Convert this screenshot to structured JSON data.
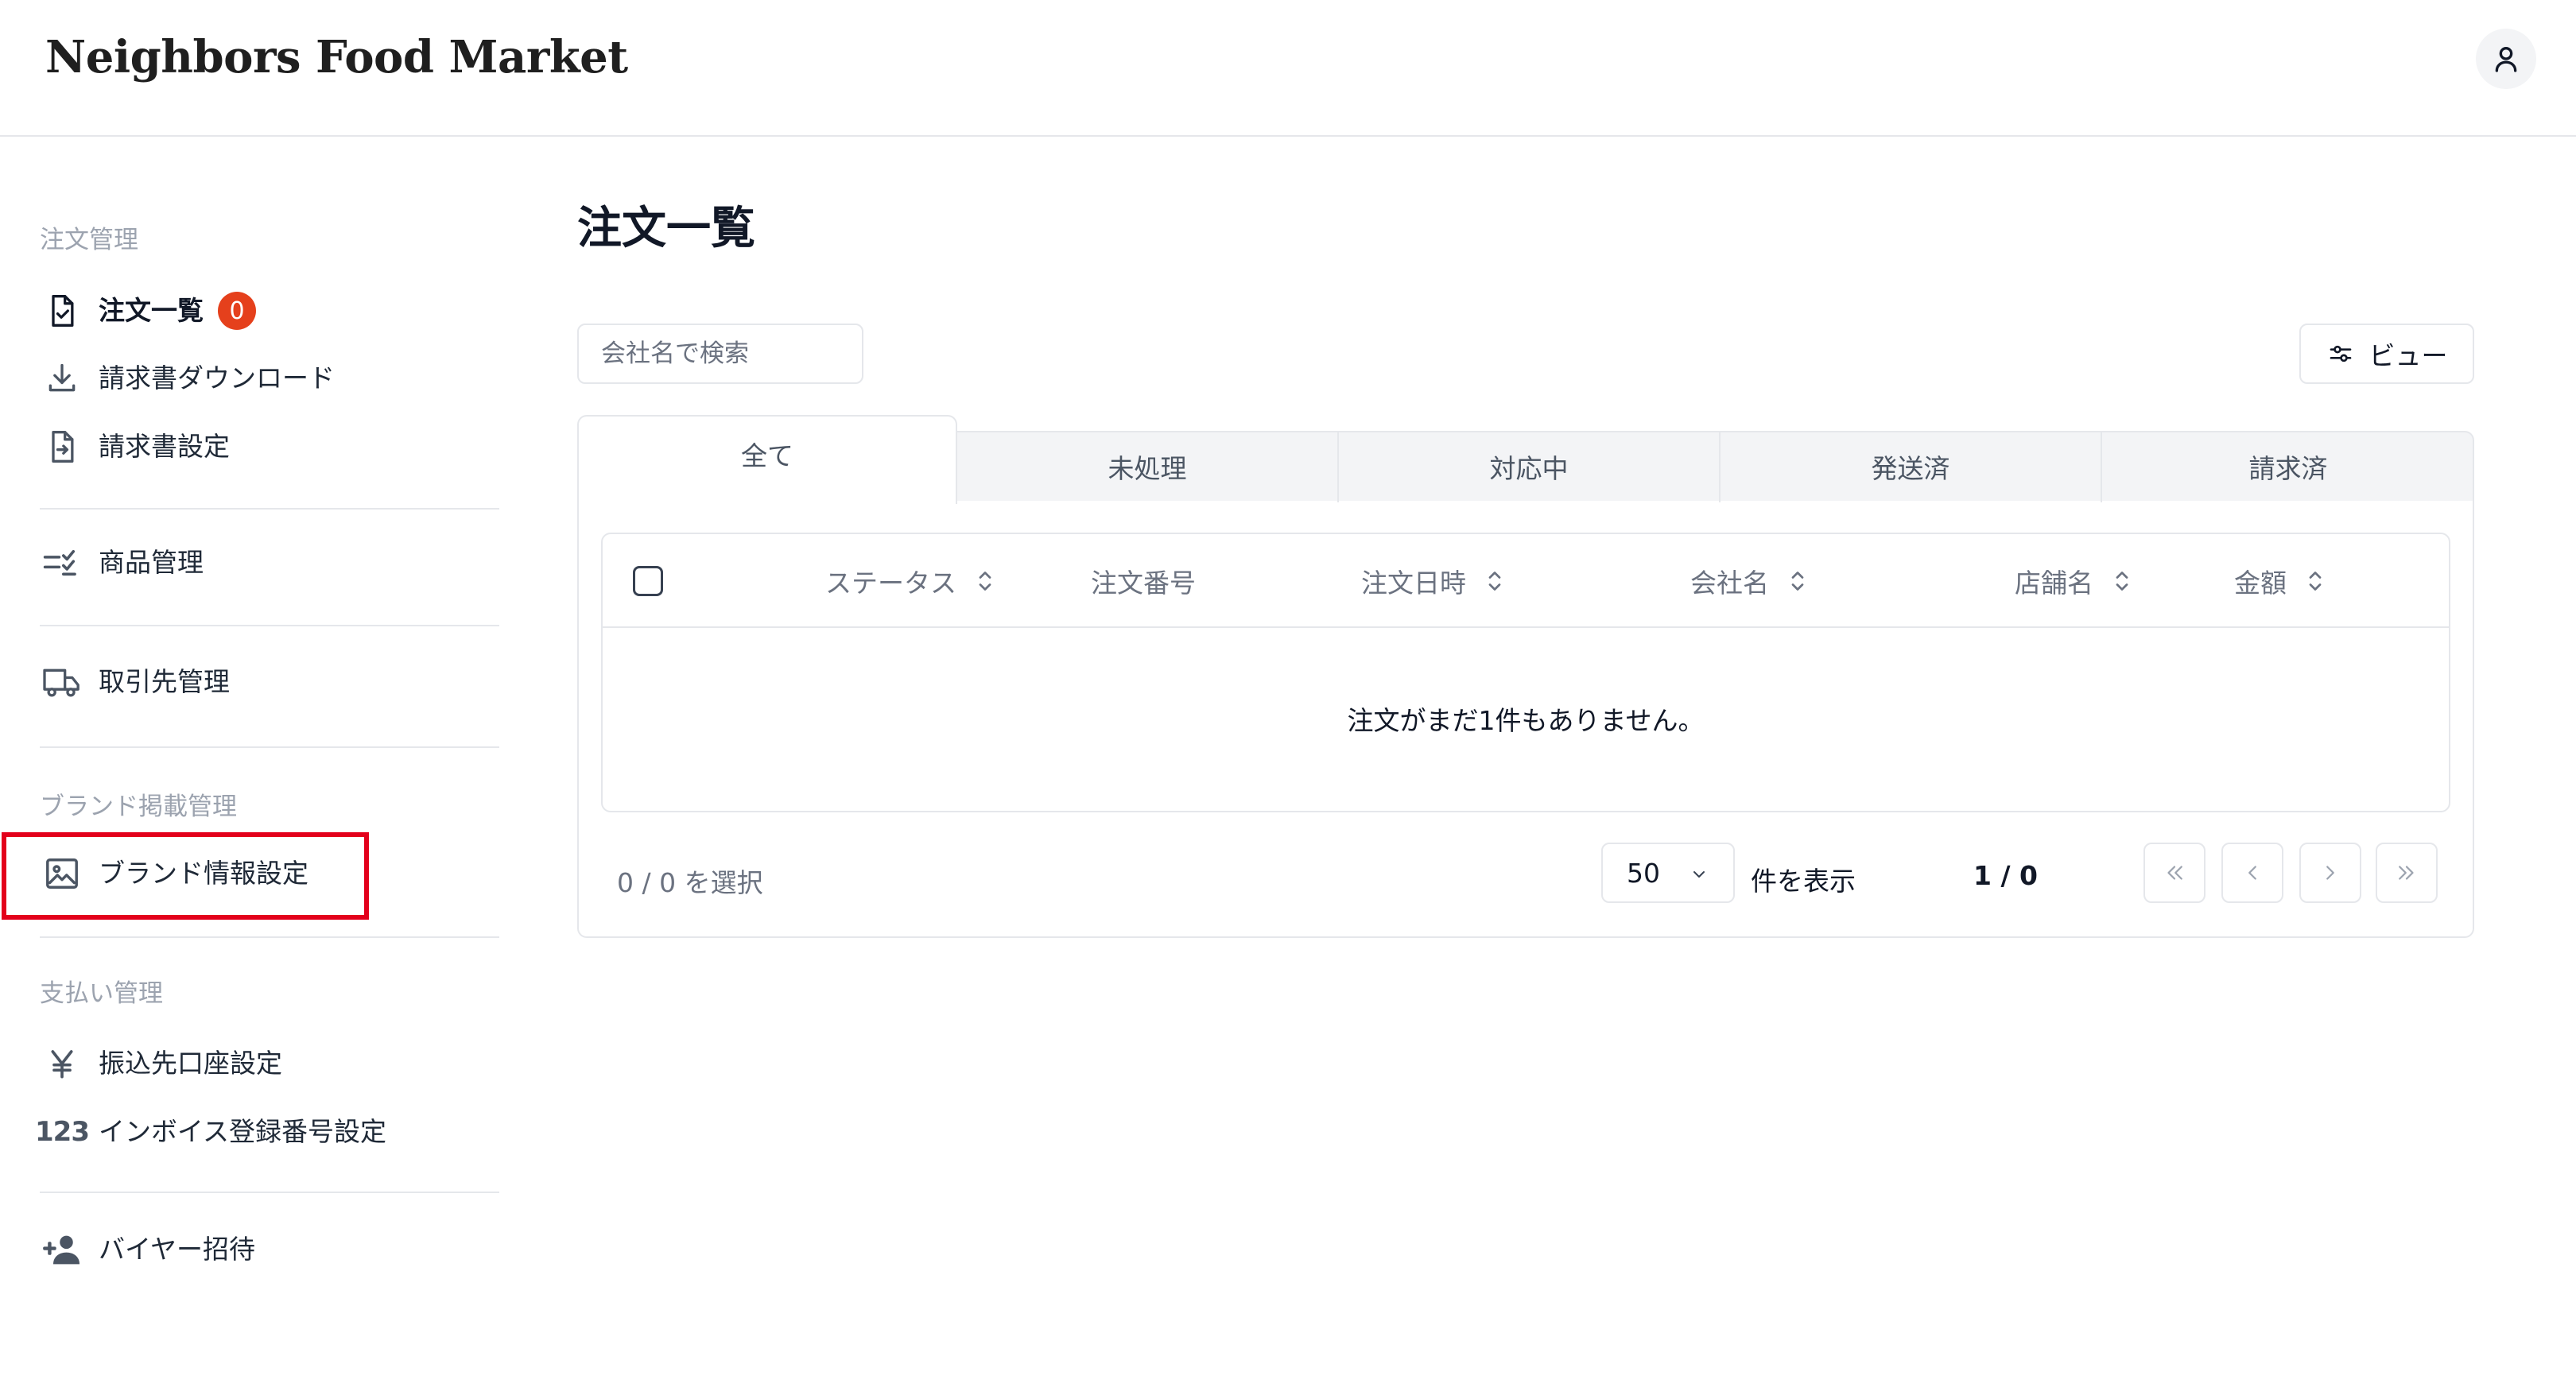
{
  "header": {
    "brand": "Neighbors Food Market",
    "user_icon": "user-icon"
  },
  "sidebar": {
    "sections": {
      "orders": "注文管理",
      "brand": "ブランド掲載管理",
      "payment": "支払い管理"
    },
    "items": {
      "order_list": {
        "label": "注文一覧",
        "badge": "0",
        "icon": "document-check-icon"
      },
      "invoice_download": {
        "label": "請求書ダウンロード",
        "icon": "download-icon"
      },
      "invoice_settings": {
        "label": "請求書設定",
        "icon": "document-arrow-icon"
      },
      "product_management": {
        "label": "商品管理",
        "icon": "list-check-icon"
      },
      "partner_management": {
        "label": "取引先管理",
        "icon": "truck-icon"
      },
      "brand_info": {
        "label": "ブランド情報設定",
        "icon": "image-icon"
      },
      "bank_account": {
        "label": "振込先口座設定",
        "icon": "yen-icon"
      },
      "invoice_number": {
        "label": "インボイス登録番号設定",
        "icon_text": "123"
      },
      "invite_buyer": {
        "label": "バイヤー招待",
        "icon": "user-plus-icon"
      }
    },
    "highlight_color": "#e3001b"
  },
  "main": {
    "title": "注文一覧",
    "search_placeholder": "会社名で検索",
    "view_button": "ビュー",
    "tabs": [
      "全て",
      "未処理",
      "対応中",
      "発送済",
      "請求済"
    ],
    "active_tab": "全て",
    "columns": [
      "ステータス",
      "注文番号",
      "注文日時",
      "会社名",
      "店舗名",
      "金額"
    ],
    "empty_message": "注文がまだ1件もありません。",
    "selected_count": "0 / 0 を選択",
    "page_size": "50",
    "per_page_label": "件を表示",
    "page_info": "1 / 0"
  },
  "colors": {
    "badge": "#e5401c",
    "tab_bar": "#f3f4f6",
    "border": "#e5e7eb"
  }
}
